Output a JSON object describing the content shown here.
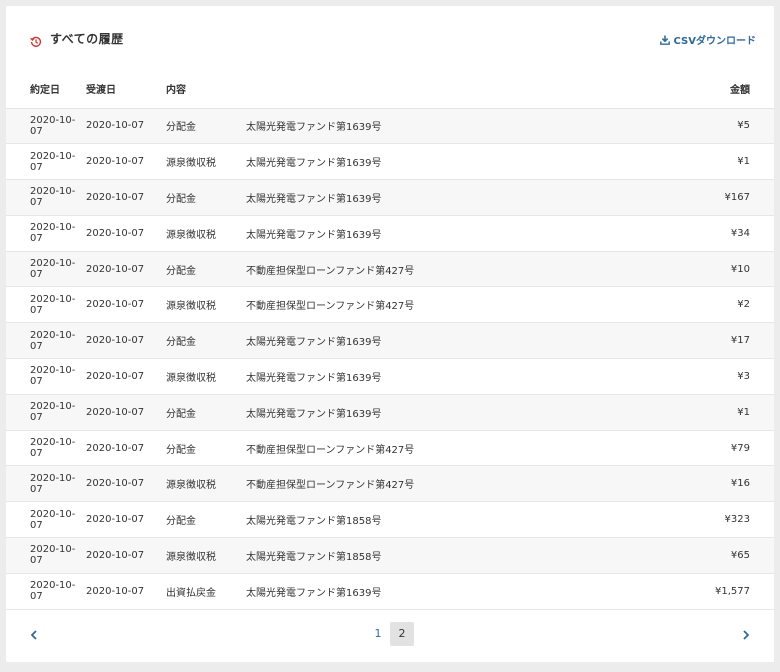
{
  "header": {
    "title": "すべての履歴",
    "csv_label": "CSVダウンロード"
  },
  "colors": {
    "accent": "#2f6a9e",
    "history_icon": "#d0342c"
  },
  "table": {
    "columns": [
      "約定日",
      "受渡日",
      "内容",
      "",
      "金額"
    ],
    "rows": [
      [
        "2020-10-07",
        "2020-10-07",
        "分配金",
        "太陽光発電ファンド第1639号",
        "¥5"
      ],
      [
        "2020-10-07",
        "2020-10-07",
        "源泉徴収税",
        "太陽光発電ファンド第1639号",
        "¥1"
      ],
      [
        "2020-10-07",
        "2020-10-07",
        "分配金",
        "太陽光発電ファンド第1639号",
        "¥167"
      ],
      [
        "2020-10-07",
        "2020-10-07",
        "源泉徴収税",
        "太陽光発電ファンド第1639号",
        "¥34"
      ],
      [
        "2020-10-07",
        "2020-10-07",
        "分配金",
        "不動産担保型ローンファンド第427号",
        "¥10"
      ],
      [
        "2020-10-07",
        "2020-10-07",
        "源泉徴収税",
        "不動産担保型ローンファンド第427号",
        "¥2"
      ],
      [
        "2020-10-07",
        "2020-10-07",
        "分配金",
        "太陽光発電ファンド第1639号",
        "¥17"
      ],
      [
        "2020-10-07",
        "2020-10-07",
        "源泉徴収税",
        "太陽光発電ファンド第1639号",
        "¥3"
      ],
      [
        "2020-10-07",
        "2020-10-07",
        "分配金",
        "太陽光発電ファンド第1639号",
        "¥1"
      ],
      [
        "2020-10-07",
        "2020-10-07",
        "分配金",
        "不動産担保型ローンファンド第427号",
        "¥79"
      ],
      [
        "2020-10-07",
        "2020-10-07",
        "源泉徴収税",
        "不動産担保型ローンファンド第427号",
        "¥16"
      ],
      [
        "2020-10-07",
        "2020-10-07",
        "分配金",
        "太陽光発電ファンド第1858号",
        "¥323"
      ],
      [
        "2020-10-07",
        "2020-10-07",
        "源泉徴収税",
        "太陽光発電ファンド第1858号",
        "¥65"
      ],
      [
        "2020-10-07",
        "2020-10-07",
        "出資払戻金",
        "太陽光発電ファンド第1639号",
        "¥1,577"
      ]
    ]
  },
  "pagination": {
    "pages": [
      "1",
      "2"
    ],
    "current": "2",
    "prev_icon": "chevron-left-icon",
    "next_icon": "chevron-right-icon"
  }
}
